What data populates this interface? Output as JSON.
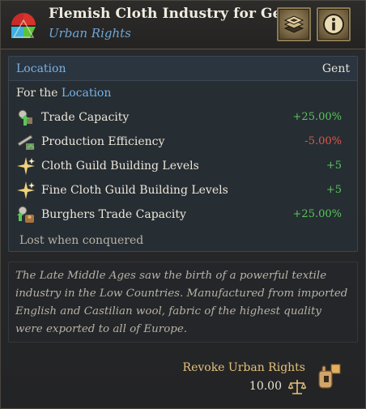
{
  "header": {
    "title": "Flemish Cloth Industry for Gent",
    "subtitle": "Urban Rights",
    "icon": "privilege-triangle-icon",
    "buttons": [
      {
        "icon": "map-layers-icon"
      },
      {
        "icon": "info-icon"
      }
    ]
  },
  "location_row": {
    "label": "Location",
    "value": "Gent"
  },
  "for_line": {
    "prefix": "For the ",
    "highlight": "Location"
  },
  "modifiers": [
    {
      "icon": "trade-capacity-icon",
      "name": "Trade Capacity",
      "value": "+25.00%",
      "sign": "positive"
    },
    {
      "icon": "production-efficiency-icon",
      "name": "Production Efficiency",
      "value": "-5.00%",
      "sign": "negative"
    },
    {
      "icon": "sparkle-building-icon",
      "name": "Cloth Guild Building Levels",
      "value": "+5",
      "sign": "positive"
    },
    {
      "icon": "sparkle-building-icon",
      "name": "Fine Cloth Guild Building Levels",
      "value": "+5",
      "sign": "positive"
    },
    {
      "icon": "burghers-icon",
      "name": "Burghers Trade Capacity",
      "value": "+25.00%",
      "sign": "positive"
    }
  ],
  "lost_note": "Lost when conquered",
  "description": "The Late Middle Ages saw the birth of a powerful textile industry in the Low Countries. Manufactured from imported English and Castilian wool, fabric of the highest quality were exported to all of Europe.",
  "footer": {
    "revoke_label": "Revoke Urban Rights",
    "cost": "10.00",
    "cost_icon": "scales-icon",
    "action_icon": "hand-revoke-icon"
  },
  "colors": {
    "positive": "#58c85a",
    "negative": "#e2574a",
    "link_blue": "#7ab3e3",
    "gold": "#e4c27a"
  }
}
